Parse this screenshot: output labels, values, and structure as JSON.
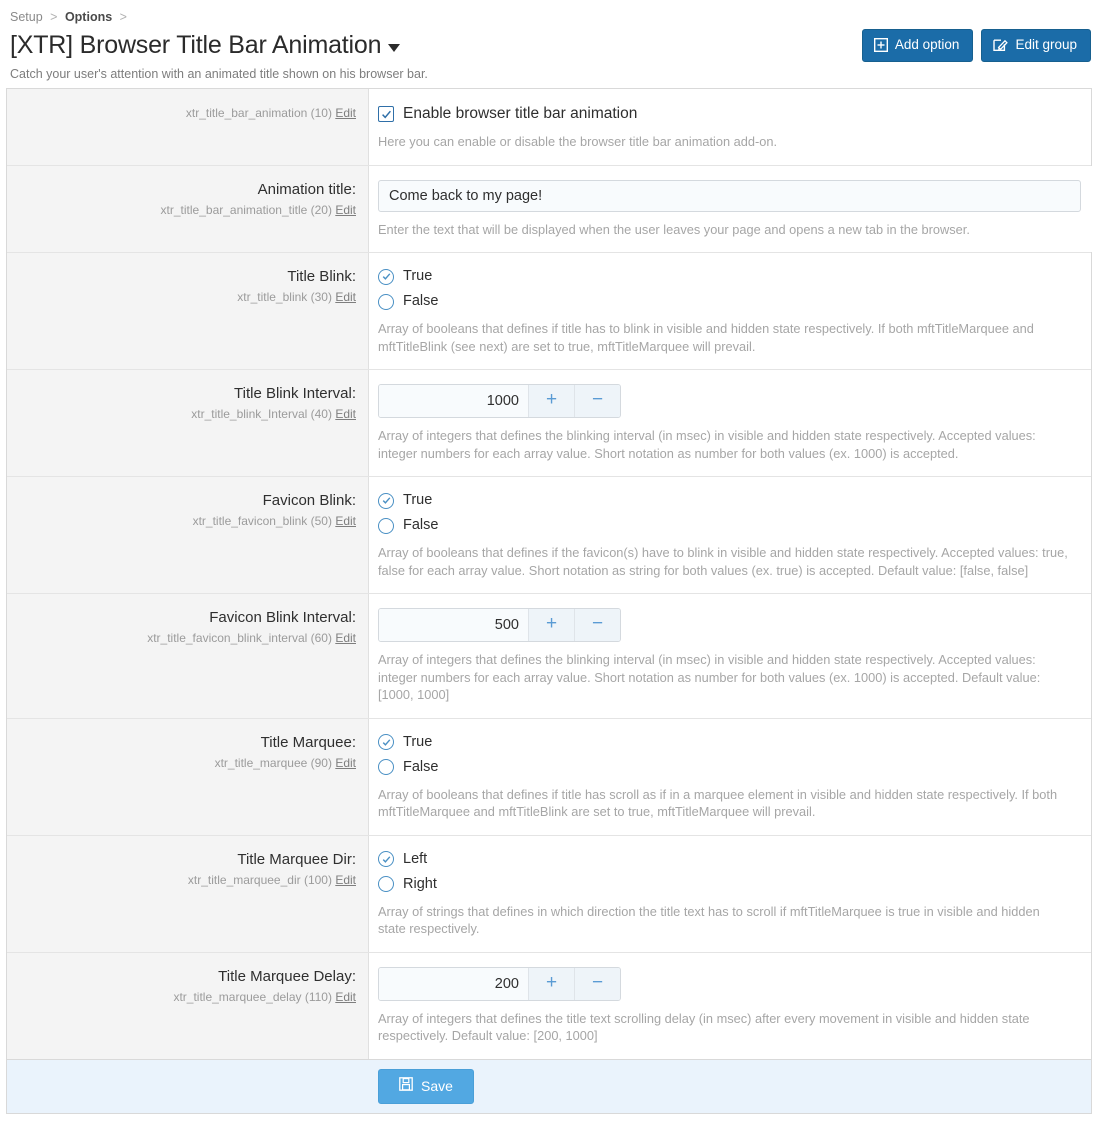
{
  "breadcrumb": {
    "items": [
      {
        "label": "Setup",
        "strong": false
      },
      {
        "label": "Options",
        "strong": true
      }
    ],
    "separator": ">"
  },
  "header": {
    "title": "[XTR] Browser Title Bar Animation",
    "subtitle": "Catch your user's attention with an animated title shown on his browser bar.",
    "caret_icon": "chevron-down-icon",
    "actions": [
      {
        "label": "Add option",
        "icon": "plus-square-icon"
      },
      {
        "label": "Edit group",
        "icon": "pencil-square-icon"
      }
    ]
  },
  "colors": {
    "header_button": "#1b6ca8",
    "save_button": "#52a8e2",
    "accent": "#4a90c4",
    "label_column_bg": "#f4f4f4",
    "footer_bg": "#eaf3fc"
  },
  "edit_link_label": "Edit",
  "rows": [
    {
      "label": "",
      "key": "xtr_title_bar_animation (10)",
      "control": "checkbox",
      "checkbox_label": "Enable browser title bar animation",
      "checked": true,
      "help": "Here you can enable or disable the browser title bar animation add-on."
    },
    {
      "label": "Animation title:",
      "key": "xtr_title_bar_animation_title (20)",
      "control": "text",
      "value": "Come back to my page!",
      "placeholder": "",
      "help": "Enter the text that will be displayed when the user leaves your page and opens a new tab in the browser."
    },
    {
      "label": "Title Blink:",
      "key": "xtr_title_blink (30)",
      "control": "radio",
      "options": [
        "True",
        "False"
      ],
      "selected": "True",
      "help": "Array of booleans that defines if title has to blink in visible and hidden state respectively. If both mftTitleMarquee and mftTitleBlink (see next) are set to true, mftTitleMarquee will prevail."
    },
    {
      "label": "Title Blink Interval:",
      "key": "xtr_title_blink_Interval (40)",
      "control": "stepper",
      "value": "1000",
      "increment_label": "+",
      "decrement_label": "−",
      "help": "Array of integers that defines the blinking interval (in msec) in visible and hidden state respectively. Accepted values: integer numbers for each array value. Short notation as number for both values (ex. 1000) is accepted."
    },
    {
      "label": "Favicon Blink:",
      "key": "xtr_title_favicon_blink (50)",
      "control": "radio",
      "options": [
        "True",
        "False"
      ],
      "selected": "True",
      "help": "Array of booleans that defines if the favicon(s) have to blink in visible and hidden state respectively. Accepted values: true, false for each array value. Short notation as string for both values (ex. true) is accepted. Default value: [false, false]"
    },
    {
      "label": "Favicon Blink Interval:",
      "key": "xtr_title_favicon_blink_interval (60)",
      "control": "stepper",
      "value": "500",
      "increment_label": "+",
      "decrement_label": "−",
      "help": "Array of integers that defines the blinking interval (in msec) in visible and hidden state respectively. Accepted values: integer numbers for each array value. Short notation as number for both values (ex. 1000) is accepted. Default value: [1000, 1000]"
    },
    {
      "label": "Title Marquee:",
      "key": "xtr_title_marquee (90)",
      "control": "radio",
      "options": [
        "True",
        "False"
      ],
      "selected": "True",
      "help": "Array of booleans that defines if title has scroll as if in a marquee element in visible and hidden state respectively. If both mftTitleMarquee and mftTitleBlink are set to true, mftTitleMarquee will prevail."
    },
    {
      "label": "Title Marquee Dir:",
      "key": "xtr_title_marquee_dir (100)",
      "control": "radio",
      "options": [
        "Left",
        "Right"
      ],
      "selected": "Left",
      "help": "Array of strings that defines in which direction the title text has to scroll if mftTitleMarquee is true in visible and hidden state respectively."
    },
    {
      "label": "Title Marquee Delay:",
      "key": "xtr_title_marquee_delay (110)",
      "control": "stepper",
      "value": "200",
      "increment_label": "+",
      "decrement_label": "−",
      "help": "Array of integers that defines the title text scrolling delay (in msec) after every movement in visible and hidden state respectively. Default value: [200, 1000]"
    }
  ],
  "footer": {
    "save_label": "Save",
    "save_icon": "floppy-disk-icon"
  }
}
